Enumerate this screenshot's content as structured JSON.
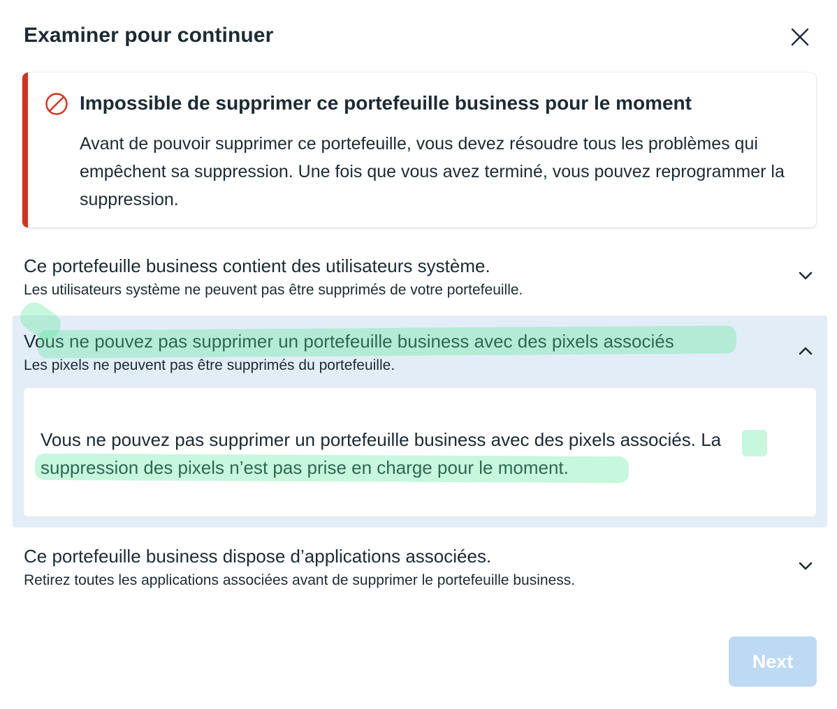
{
  "dialog": {
    "title": "Examiner pour continuer",
    "close_icon": "close-icon"
  },
  "alert": {
    "icon": "prohibited-icon",
    "accent_color": "#d6311f",
    "title": "Impossible de supprimer ce portefeuille business pour le moment",
    "body": "Avant de pouvoir supprimer ce portefeuille, vous devez résoudre tous les problèmes qui empêchent sa suppression. Une fois que vous avez terminé, vous pouvez reprogrammer la suppression."
  },
  "issues": [
    {
      "title": "Ce portefeuille business contient des utilisateurs système.",
      "subtitle": "Les utilisateurs système ne peuvent pas être supprimés de votre portefeuille.",
      "expanded": false
    },
    {
      "title": "Vous ne pouvez pas supprimer un portefeuille business avec des pixels associés",
      "subtitle": "Les pixels ne peuvent pas être supprimés du portefeuille.",
      "expanded": true,
      "detail": "Vous ne pouvez pas supprimer un portefeuille business avec des pixels associés. La suppression des pixels n’est pas prise en charge pour le moment."
    },
    {
      "title": "Ce portefeuille business dispose d’applications associées.",
      "subtitle": "Retirez toutes les applications associées avant de supprimer le portefeuille business.",
      "expanded": false
    }
  ],
  "footer": {
    "next_label": "Next",
    "next_disabled": true
  },
  "colors": {
    "text": "#1c2b33",
    "expanded_bg": "#e3edf7",
    "disabled_button": "#bed9f3",
    "highlight": "#50e696"
  }
}
